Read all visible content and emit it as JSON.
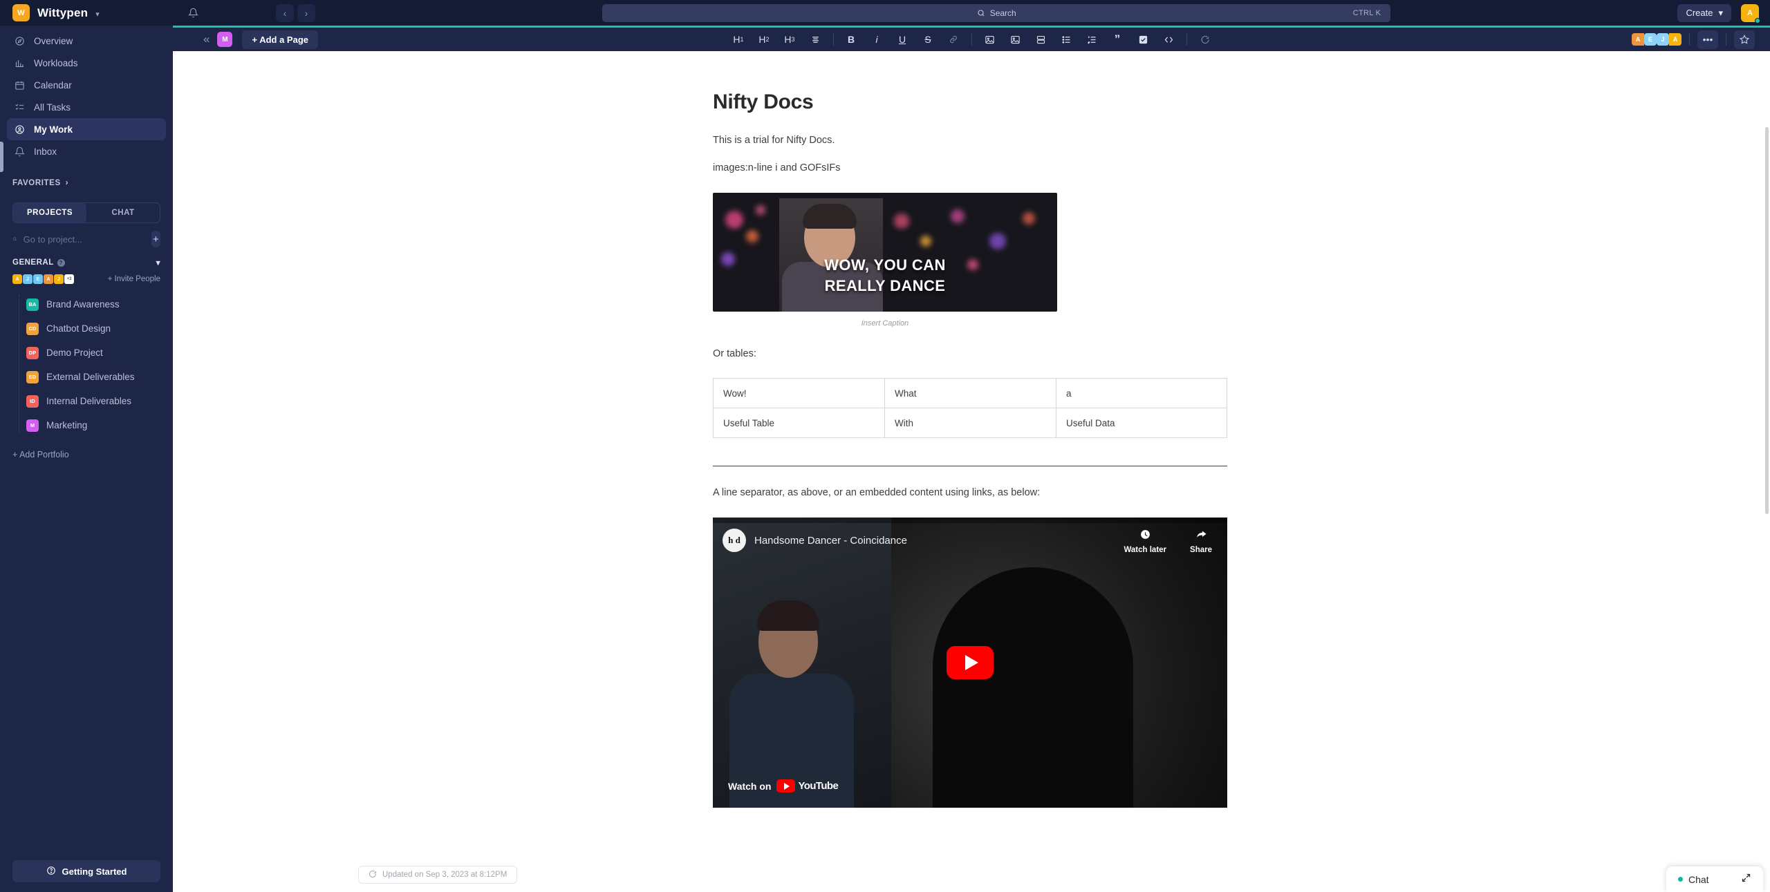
{
  "topbar": {
    "brand_initial": "W",
    "brand_name": "Wittypen",
    "bell_icon": "bell-icon",
    "back_icon": "chevron-left-icon",
    "forward_icon": "chevron-right-icon",
    "search_placeholder": "Search",
    "search_shortcut": "CTRL K",
    "create_label": "Create",
    "user_initial": "A"
  },
  "sidebar": {
    "nav": [
      {
        "label": "Overview",
        "icon": "compass-icon",
        "active": false
      },
      {
        "label": "Workloads",
        "icon": "bar-chart-icon",
        "active": false
      },
      {
        "label": "Calendar",
        "icon": "calendar-icon",
        "active": false
      },
      {
        "label": "All Tasks",
        "icon": "checklist-icon",
        "active": false
      },
      {
        "label": "My Work",
        "icon": "target-person-icon",
        "active": true
      },
      {
        "label": "Inbox",
        "icon": "bell-icon",
        "active": false
      }
    ],
    "favorites_label": "FAVORITES",
    "tabs": [
      {
        "label": "PROJECTS",
        "active": true
      },
      {
        "label": "CHAT",
        "active": false
      }
    ],
    "project_search_placeholder": "Go to project...",
    "add_project_label": "+",
    "group_label": "GENERAL",
    "invite_label": "+ Invite People",
    "member_avatars": [
      {
        "initial": "A",
        "color": "#f5b312"
      },
      {
        "initial": "J",
        "color": "#6ec6f5"
      },
      {
        "initial": "E",
        "color": "#6ec6f5"
      },
      {
        "initial": "A",
        "color": "#f0943c"
      },
      {
        "initial": "J",
        "color": "#f5b312"
      },
      {
        "initial": "+3",
        "color": "#ffffff"
      }
    ],
    "projects": [
      {
        "label": "Brand Awareness",
        "initials": "BA",
        "color": "#16b9a6"
      },
      {
        "label": "Chatbot Design",
        "initials": "CD",
        "color": "#f0a33c"
      },
      {
        "label": "Demo Project",
        "initials": "DP",
        "color": "#f5625d"
      },
      {
        "label": "External Deliverables",
        "initials": "ED",
        "color": "#f0a33c"
      },
      {
        "label": "Internal Deliverables",
        "initials": "ID",
        "color": "#f5625d"
      },
      {
        "label": "Marketing",
        "initials": "M",
        "color": "#d25ff0"
      }
    ],
    "add_portfolio_label": "+ Add Portfolio",
    "getting_started_label": "Getting Started"
  },
  "dochead": {
    "collapse_icon": "double-chevron-left-icon",
    "page_badge": "M",
    "add_page_label": "+ Add a Page",
    "toolbar": [
      {
        "name": "heading-1-button",
        "glyph": "H1"
      },
      {
        "name": "heading-2-button",
        "glyph": "H2"
      },
      {
        "name": "heading-3-button",
        "glyph": "H3"
      },
      {
        "name": "text-align-button",
        "glyph": "align"
      },
      {
        "sep": true
      },
      {
        "name": "bold-button",
        "glyph": "B"
      },
      {
        "name": "italic-button",
        "glyph": "i"
      },
      {
        "name": "underline-button",
        "glyph": "U"
      },
      {
        "name": "strikethrough-button",
        "glyph": "S"
      },
      {
        "name": "link-button",
        "glyph": "link"
      },
      {
        "sep": true
      },
      {
        "name": "image-button",
        "glyph": "image"
      },
      {
        "name": "embed-image-button",
        "glyph": "image"
      },
      {
        "name": "layout-button",
        "glyph": "layout"
      },
      {
        "name": "bullet-list-button",
        "glyph": "ul"
      },
      {
        "name": "numbered-list-button",
        "glyph": "ol"
      },
      {
        "name": "quote-button",
        "glyph": "quote"
      },
      {
        "name": "checkbox-button",
        "glyph": "check"
      },
      {
        "name": "code-button",
        "glyph": "code"
      },
      {
        "sep": true
      },
      {
        "name": "comment-button",
        "glyph": "comment"
      }
    ],
    "collaborators": [
      {
        "initial": "A",
        "color": "#f0943c"
      },
      {
        "initial": "E",
        "color": "#8ed3f7"
      },
      {
        "initial": "J",
        "color": "#8ed3f7"
      },
      {
        "initial": "A",
        "color": "#f5b312"
      }
    ],
    "more_label": "•••",
    "favorite_icon": "star-icon"
  },
  "document": {
    "title": "Nifty Docs",
    "paragraph_1": "This is a trial for Nifty Docs.",
    "paragraph_2": "images:n-line i and GOFsIFs",
    "gif": {
      "line1": "WOW, YOU CAN",
      "line2": "REALLY DANCE",
      "caption": "Insert Caption"
    },
    "paragraph_3": "Or tables:",
    "table": {
      "rows": [
        [
          "Wow!",
          "What",
          "a"
        ],
        [
          "Useful Table",
          "With",
          "Useful Data"
        ]
      ]
    },
    "paragraph_4": "A line separator, as above, or an embedded content using links, as below:",
    "video": {
      "channel_initials": "h d",
      "title": "Handsome Dancer - Coincidance",
      "watch_later_label": "Watch later",
      "share_label": "Share",
      "watch_on_label": "Watch on",
      "platform": "YouTube",
      "play_icon": "play-button-icon"
    },
    "updated_text": "Updated on Sep 3, 2023 at 8:12PM",
    "updated_icon": "refresh-icon"
  },
  "chat_widget": {
    "label": "Chat",
    "expand_icon": "expand-diagonal-icon"
  },
  "colors": {
    "sidebar_bg": "#1d2647",
    "topbar_bg": "#141b34",
    "accent_teal": "#17c6a4",
    "brand_orange": "#f5a623",
    "active_nav": "#2c3560"
  }
}
